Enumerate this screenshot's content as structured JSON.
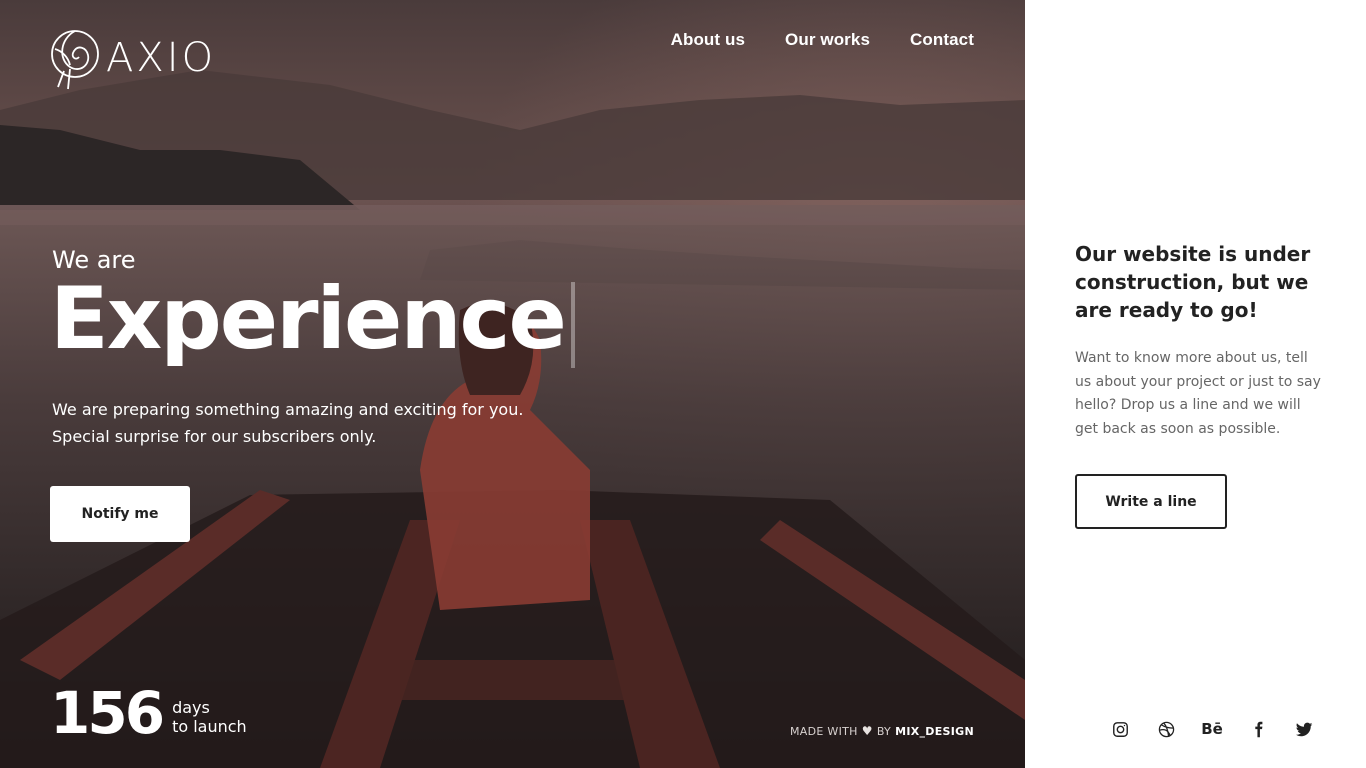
{
  "brand": {
    "name": "AXIO",
    "logo_icon": "shell-icon"
  },
  "nav": {
    "items": [
      {
        "label": "About us"
      },
      {
        "label": "Our works"
      },
      {
        "label": "Contact"
      }
    ]
  },
  "hero": {
    "intro": "We are",
    "headline": "Experience",
    "subtext_line1": "We are preparing something amazing and exciting for you.",
    "subtext_line2": "Special surprise for our subscribers only.",
    "notify_label": "Notify me"
  },
  "countdown": {
    "number": "156",
    "line1": "days",
    "line2": "to launch"
  },
  "footer": {
    "made_with": "MADE WITH",
    "by": "BY",
    "author": "MIX_DESIGN"
  },
  "panel": {
    "title": "Our website is under construction, but we are ready to go!",
    "text": "Want to know more about us, tell us about your project or just to say hello? Drop us a line and we will get back as soon as possible.",
    "button_label": "Write a line",
    "behance_label": "Bē"
  },
  "socials": [
    "instagram-icon",
    "dribbble-icon",
    "behance-icon",
    "facebook-icon",
    "twitter-icon"
  ],
  "colors": {
    "panel_bg": "#ffffff",
    "text_dark": "#222222",
    "text_muted": "#666666",
    "hero_overlay": "#2a2424"
  }
}
